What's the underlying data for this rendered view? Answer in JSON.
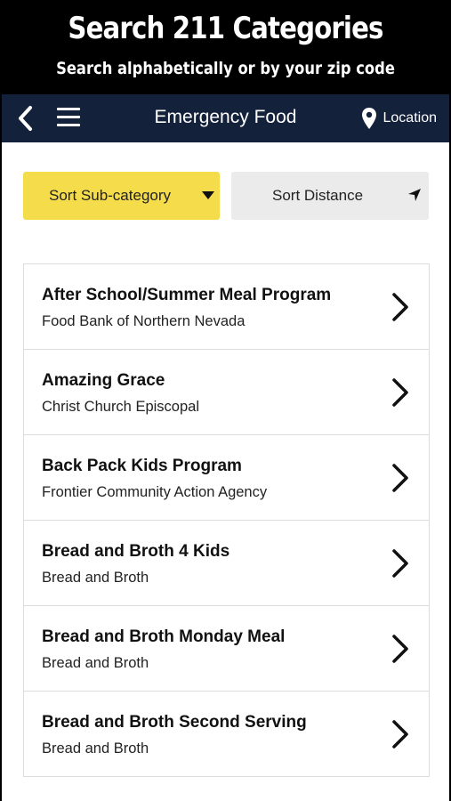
{
  "promo": {
    "title": "Search 211 Categories",
    "subtitle": "Search alphabetically or by your zip code"
  },
  "navbar": {
    "back_icon": "chevron-left-icon",
    "menu_icon": "hamburger-menu-icon",
    "title": "Emergency Food",
    "location_icon": "map-pin-icon",
    "location_label": "Location",
    "background": "#14213b"
  },
  "sort": {
    "subcategory_label": "Sort Sub-category",
    "subcategory_color": "#f5dc4a",
    "distance_label": "Sort Distance"
  },
  "list": {
    "items": [
      {
        "title": "After School/Summer Meal Program",
        "subtitle": "Food Bank of Northern Nevada"
      },
      {
        "title": "Amazing Grace",
        "subtitle": "Christ Church Episcopal"
      },
      {
        "title": "Back Pack Kids Program",
        "subtitle": "Frontier Community Action Agency"
      },
      {
        "title": "Bread and Broth 4 Kids",
        "subtitle": "Bread and Broth"
      },
      {
        "title": "Bread and Broth Monday Meal",
        "subtitle": "Bread and Broth"
      },
      {
        "title": "Bread and Broth Second Serving",
        "subtitle": "Bread and Broth"
      }
    ]
  }
}
